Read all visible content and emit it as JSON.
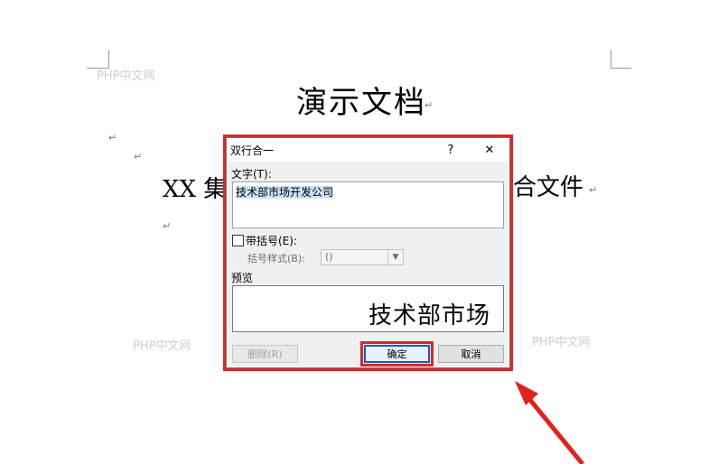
{
  "document": {
    "title": "演示文档",
    "line_left": "XX 集",
    "line_right": "合文件",
    "paragraph_mark": "↵",
    "watermarks": [
      "PHP中文网",
      "PHP中文网",
      "PHP中文网"
    ]
  },
  "dialog": {
    "title": "双行合一",
    "help_label": "?",
    "close_label": "✕",
    "text_label": "文字(T):",
    "text_value": "技术部市场开发公司",
    "bracket_checkbox_label": "带括号(E):",
    "bracket_checked": false,
    "bracket_style_label": "括号样式(B):",
    "bracket_style_value": "()",
    "preview_label": "预览",
    "preview_text": "技术部市场",
    "delete_button": "删除(R)",
    "ok_button": "确定",
    "cancel_button": "取消"
  },
  "colors": {
    "highlight": "#d32a2a",
    "focus_border": "#1f55c4"
  }
}
